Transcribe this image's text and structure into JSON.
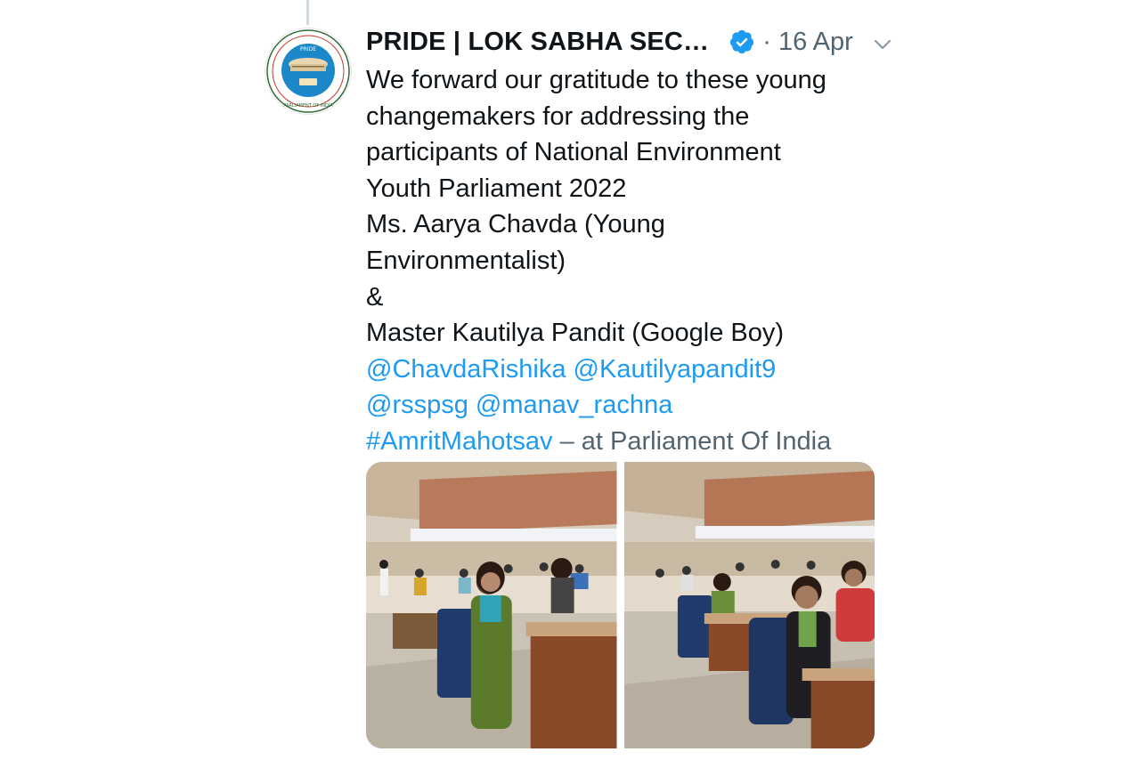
{
  "tweet": {
    "author_name": "PRIDE | LOK SABHA SEC…",
    "dot": "·",
    "date": "16 Apr",
    "lines": [
      "We forward our gratitude to these young",
      "changemakers for addressing the",
      "participants of National Environment",
      "Youth Parliament 2022",
      "Ms. Aarya Chavda (Young",
      "Environmentalist)",
      "&",
      "Master Kautilya Pandit (Google Boy)"
    ],
    "mentions_line1": [
      "@ChavdaRishika",
      "@Kautilyapandit9"
    ],
    "mentions_line2": [
      "@rsspsg",
      "@manav_rachna"
    ],
    "hashtag": "#AmritMahotsav",
    "location_text": "– at Parliament Of India"
  },
  "icons": {
    "avatar": "pride-logo-icon",
    "verified": "verified-badge-icon",
    "menu": "chevron-down-icon"
  },
  "colors": {
    "text": "#0f1419",
    "secondary": "#536471",
    "link": "#1d9bf0",
    "verified": "#1d9bf0"
  },
  "media": {
    "count": 2
  }
}
